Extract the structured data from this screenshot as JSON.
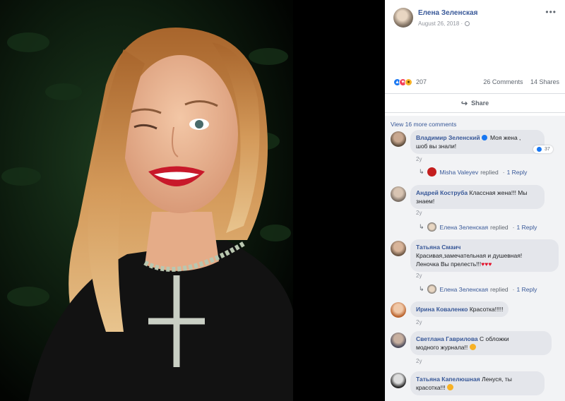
{
  "photo": {
    "subject": "woman-portrait"
  },
  "post": {
    "author": "Елена Зеленская",
    "date": "August 26, 2018 ·",
    "reactions_count": "207",
    "comments_count": "26 Comments",
    "shares_count": "14 Shares",
    "share_label": "Share",
    "view_more": "View 16 more comments"
  },
  "comments": [
    {
      "name": "Владимир Зеленский",
      "text_line1": "Моя жена ,",
      "text_line2": "шоб вы знали!",
      "time": "2y",
      "likes": "37",
      "reply": {
        "name": "Misha Valeyev",
        "action": "replied",
        "sep": "·",
        "link": "1 Reply"
      }
    },
    {
      "name": "Андрей Коструба",
      "text_line1": "Классная жена!!! Мы",
      "text_line2": "знаем!",
      "time": "2y",
      "reply": {
        "name": "Елена Зеленская",
        "action": "replied",
        "sep": "·",
        "link": "1 Reply"
      }
    },
    {
      "name": "Татьяна Смаич",
      "text_line1": "Красивая,замечательная и душевная!",
      "text_line2": "Леночка Вы прелесть!!!",
      "time": "2y",
      "reply": {
        "name": "Елена Зеленская",
        "action": "replied",
        "sep": "·",
        "link": "1 Reply"
      }
    },
    {
      "name": "Ирина Коваленко",
      "text_line1": "Красотка!!!!!",
      "time": "2y"
    },
    {
      "name": "Светлана Гаврилова",
      "text_line1": "С обложки",
      "text_line2": "модного журнала!!",
      "time": "2y"
    },
    {
      "name": "Татьяна Капелюшная",
      "text_line1": "Ленуся, ты",
      "text_line2": "красотка!!!",
      "time": ""
    }
  ],
  "colors": {
    "link": "#385898",
    "like": "#1877f2",
    "love": "#f33e58",
    "haha": "#f7b125"
  }
}
